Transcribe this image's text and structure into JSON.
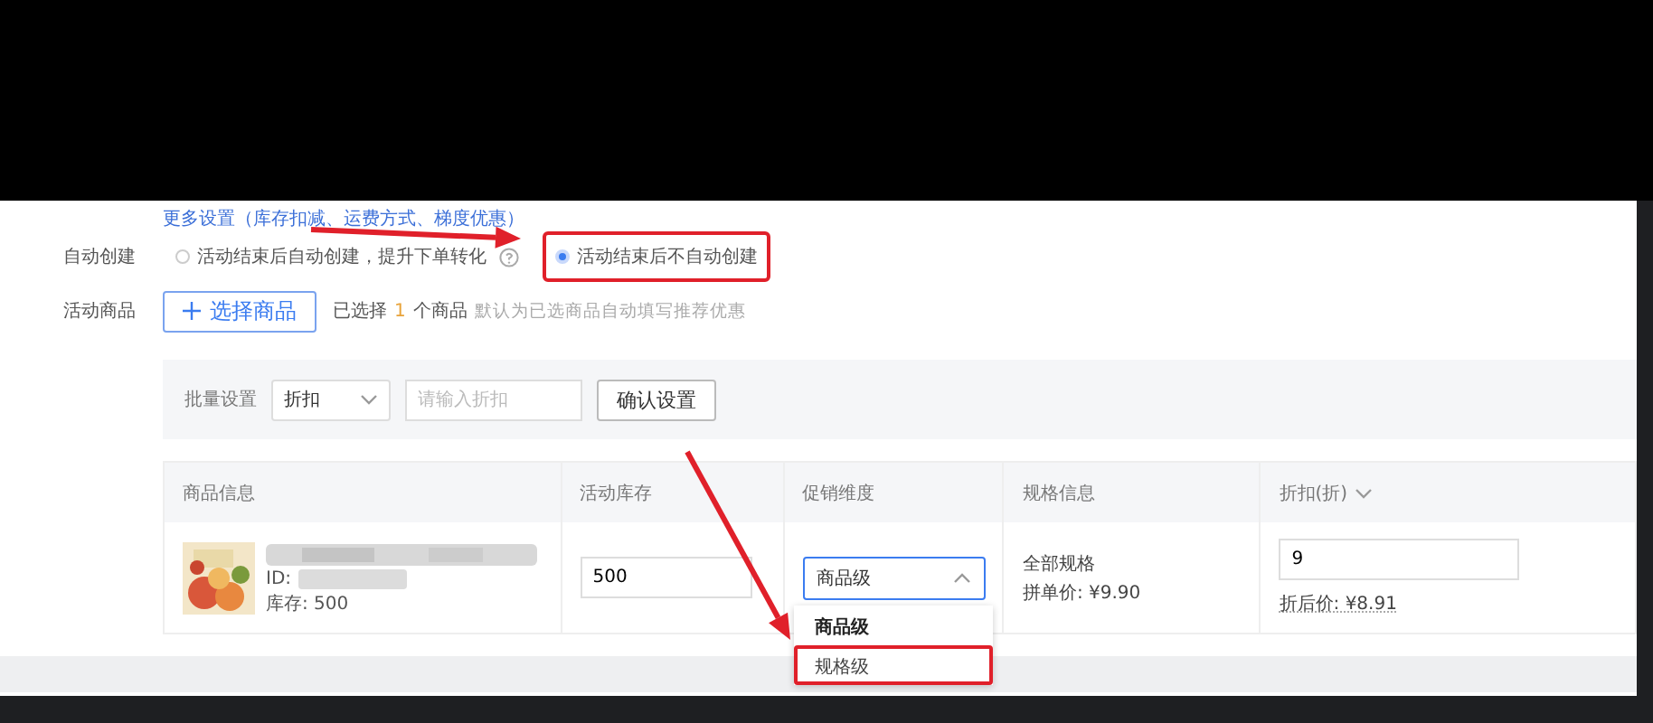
{
  "more_settings": {
    "label": "更多设置（库存扣减、运费方式、梯度优惠）"
  },
  "auto_create": {
    "label": "自动创建",
    "options": [
      {
        "label": "活动结束后自动创建，提升下单转化",
        "selected": false,
        "has_help": true,
        "highlighted": false
      },
      {
        "label": "活动结束后不自动创建",
        "selected": true,
        "has_help": false,
        "highlighted": true
      }
    ]
  },
  "products": {
    "label": "活动商品",
    "button": "选择商品",
    "selected_prefix": "已选择",
    "count": "1",
    "selected_suffix": "个商品",
    "hint": "默认为已选商品自动填写推荐优惠"
  },
  "batch": {
    "label": "批量设置",
    "select_value": "折扣",
    "placeholder": "请输入折扣",
    "button": "确认设置"
  },
  "table": {
    "columns": [
      {
        "label": "商品信息",
        "has_menu": false
      },
      {
        "label": "活动库存",
        "has_menu": false
      },
      {
        "label": "促销维度",
        "has_menu": false
      },
      {
        "label": "规格信息",
        "has_menu": false
      },
      {
        "label": "折扣(折)",
        "has_menu": true
      }
    ],
    "rows": [
      {
        "id_label": "ID:",
        "stock": "库存: 500",
        "stock_value": "500",
        "dimension": {
          "value": "商品级",
          "expanded": true,
          "options": [
            {
              "label": "商品级",
              "selected": true,
              "highlighted": false
            },
            {
              "label": "规格级",
              "selected": false,
              "highlighted": true
            }
          ]
        },
        "spec": "全部规格",
        "price": "拼单价: ¥9.90",
        "discount_value": "9",
        "discounted_price": "折后价: ¥8.91"
      }
    ]
  },
  "annotations": [
    {
      "kind": "arrow"
    },
    {
      "kind": "arrow"
    }
  ]
}
